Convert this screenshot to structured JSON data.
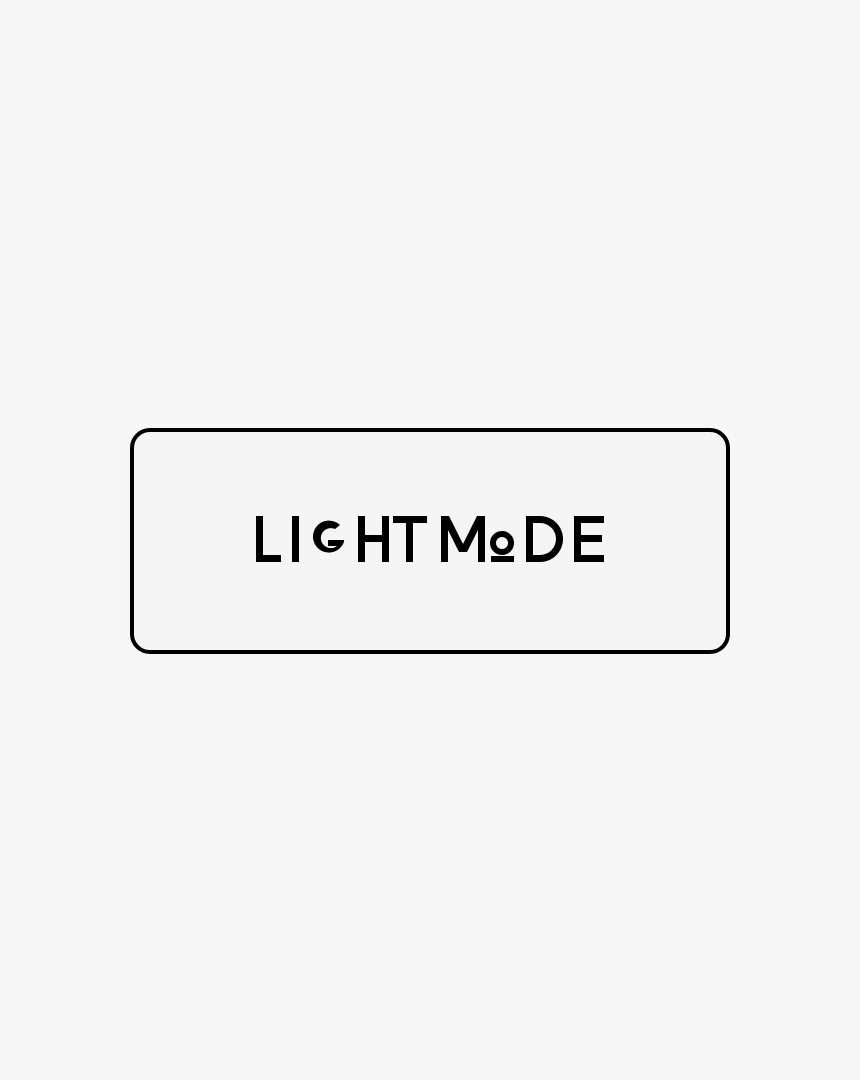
{
  "button": {
    "label": "LIGHT MODE"
  },
  "colors": {
    "background": "#f7f7f7",
    "button_fill": "#f5f5f5",
    "stroke": "#000000"
  }
}
